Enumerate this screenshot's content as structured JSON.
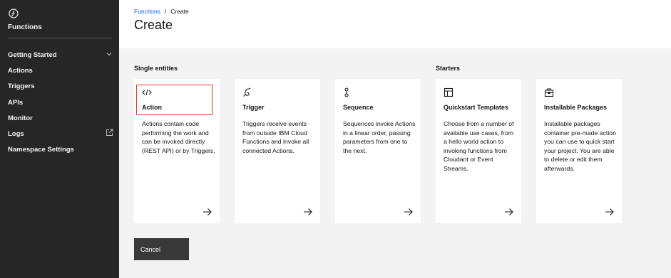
{
  "app": {
    "title": "Functions"
  },
  "sidebar": {
    "items": [
      {
        "label": "Getting Started"
      },
      {
        "label": "Actions"
      },
      {
        "label": "Triggers"
      },
      {
        "label": "APIs"
      },
      {
        "label": "Monitor"
      },
      {
        "label": "Logs"
      },
      {
        "label": "Namespace Settings"
      }
    ]
  },
  "breadcrumb": {
    "parent": "Functions",
    "separator": "/",
    "current": "Create"
  },
  "page": {
    "title": "Create"
  },
  "sections": {
    "single": "Single entities",
    "starters": "Starters"
  },
  "cards": [
    {
      "icon": "code-icon",
      "title": "Action",
      "description": "Actions contain code performing the work and can be invoked directly (REST API) or by Triggers."
    },
    {
      "icon": "trigger-icon",
      "title": "Trigger",
      "description": "Triggers receive events from outside IBM Cloud Functions and invoke all connected Actions."
    },
    {
      "icon": "sequence-icon",
      "title": "Sequence",
      "description": "Sequences invoke Actions in a linear order, passing parameters from one to the next."
    },
    {
      "icon": "template-icon",
      "title": "Quickstart Templates",
      "description": "Choose from a number of available use cases, from a hello world action to invoking functions from Cloudant or Event Streams."
    },
    {
      "icon": "package-icon",
      "title": "Installable Packages",
      "description": "Installable packages container pre-made action you can use to quick start your project. You are able to delete or edit them afterwards."
    }
  ],
  "actions": {
    "cancel": "Cancel"
  },
  "colors": {
    "sidebar": "#262626",
    "link": "#0f62fe",
    "highlight": "#e0372c",
    "button": "#393939"
  }
}
